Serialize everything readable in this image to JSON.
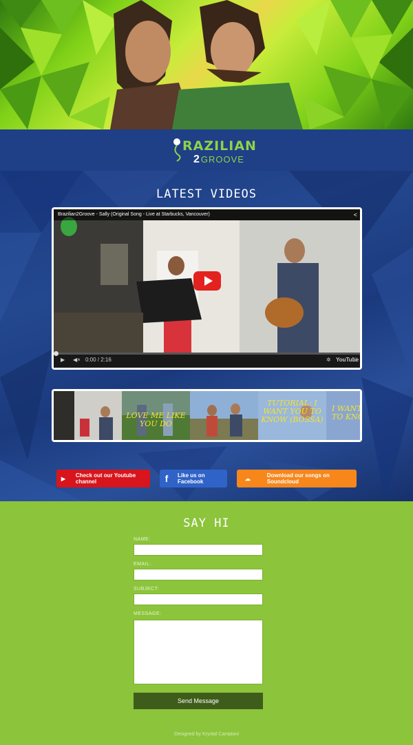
{
  "hero": {
    "alt": "Brazilian2Groove duo portrait"
  },
  "logo": {
    "line1": "RAZILIAN",
    "two": "2",
    "line2": "GROOVE",
    "first_letter": "B"
  },
  "videos": {
    "title": "Latest Videos",
    "player": {
      "video_title": "Brazilian2Groove - Sally (Original Song - Live at Starbucks, Vancouver)",
      "time": "0:00 / 2:16",
      "youtube_label": "YouTube"
    },
    "thumbnails": [
      {
        "title": ""
      },
      {
        "title": "LOVE ME LIKE YOU DO"
      },
      {
        "title": ""
      },
      {
        "title": "TUTORIAL: I WANT YOU TO KNOW (BOSSA)"
      },
      {
        "title": "I WANT YOU TO KNOW"
      }
    ],
    "social": {
      "youtube": "Check out our Youtube channel",
      "facebook": "Like us on Facebook",
      "soundcloud": "Download our songs on Soundcloud"
    }
  },
  "contact": {
    "title": "Say Hi",
    "name_label": "NAME:",
    "email_label": "EMAIL:",
    "subject_label": "SUBJECT:",
    "message_label": "MESSAGE:",
    "send_label": "Send Message"
  },
  "footer": {
    "credit": "Designed by Krystal Campioni"
  },
  "colors": {
    "logo_bar": "#1f3f86",
    "green": "#8cc43c",
    "send": "#3e5d1a",
    "youtube": "#d8151c",
    "facebook": "#2f63c8",
    "soundcloud": "#f7861b"
  }
}
